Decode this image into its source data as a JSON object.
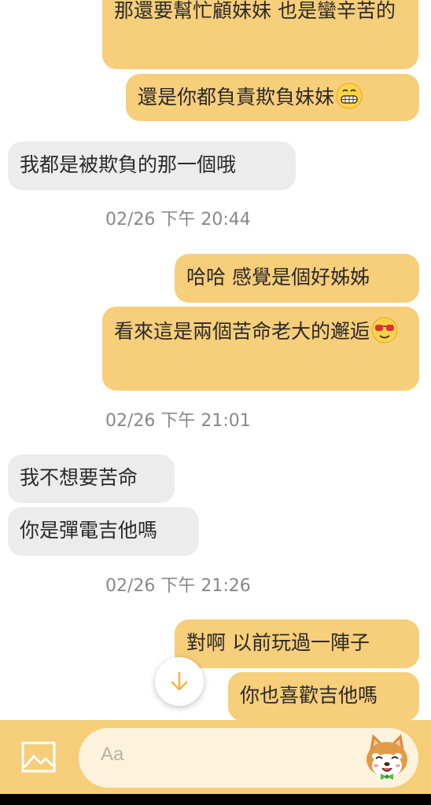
{
  "colors": {
    "outgoing_bubble": "#f7ce79",
    "incoming_bubble": "#ececec",
    "composer_bar": "#f6cd78",
    "scroll_arrow": "#f0b640"
  },
  "messages": [
    {
      "dir": "out",
      "text": "那還要幫忙顧妹妹 也是蠻辛苦的"
    },
    {
      "dir": "out",
      "text": "還是你都負責欺負妹妹",
      "emoji": "grinning-face-icon"
    },
    {
      "dir": "in",
      "text": "我都是被欺負的那一個哦"
    },
    {
      "timestamp": "02/26 下午 20:44"
    },
    {
      "dir": "out",
      "text": "哈哈 感覺是個好姊姊"
    },
    {
      "dir": "out",
      "text": "看來這是兩個苦命老大的邂逅",
      "emoji": "sunglasses-face-icon"
    },
    {
      "timestamp": "02/26 下午 21:01"
    },
    {
      "dir": "in",
      "text": "我不想要苦命"
    },
    {
      "dir": "in",
      "text": "你是彈電吉他嗎"
    },
    {
      "timestamp": "02/26 下午 21:26"
    },
    {
      "dir": "out",
      "text": "對啊 以前玩過一陣子"
    },
    {
      "dir": "out",
      "text": "你也喜歡吉他嗎"
    }
  ],
  "composer": {
    "placeholder": "Aa",
    "image_icon": "image-icon",
    "sticker_icon": "shiba-sticker-icon"
  },
  "scroll_button_icon": "arrow-down-icon"
}
